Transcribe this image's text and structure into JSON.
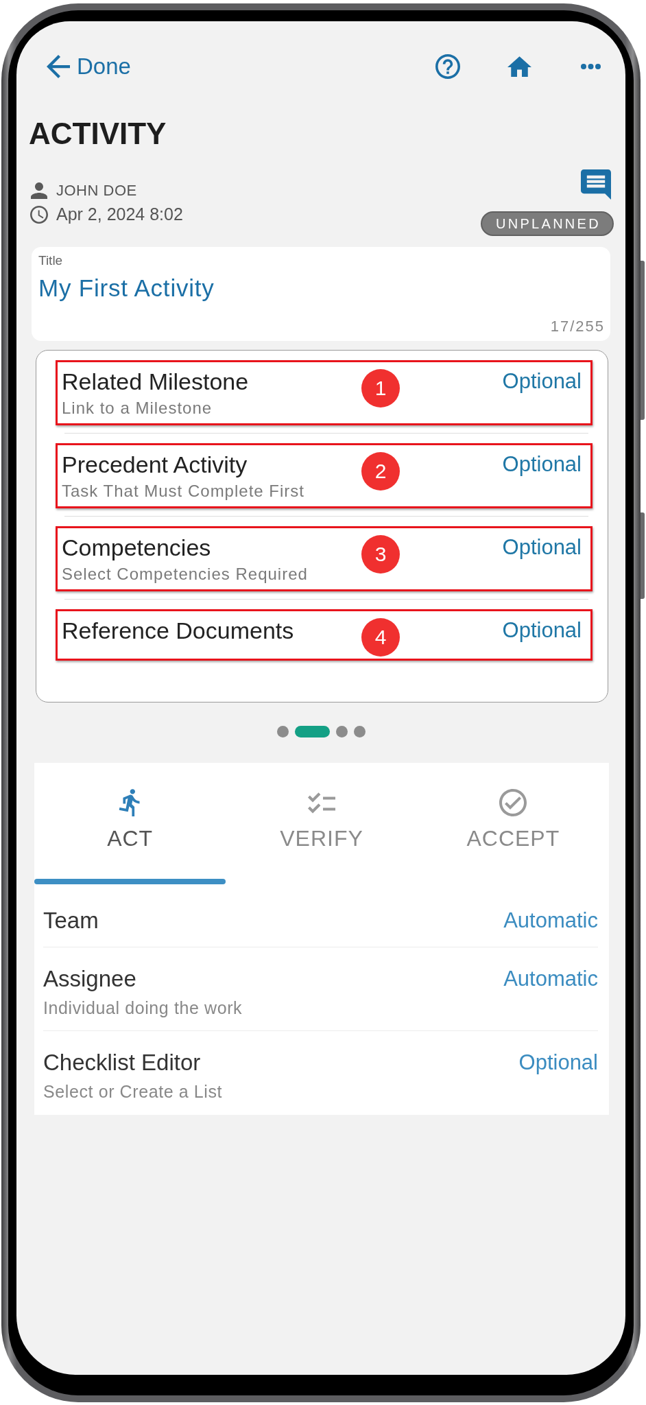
{
  "header": {
    "back_label": "Done"
  },
  "page_title": "ACTIVITY",
  "meta": {
    "owner": "JOHN DOE",
    "timestamp": "Apr 2, 2024 8:02",
    "status_badge": "UNPLANNED"
  },
  "title_field": {
    "label": "Title",
    "value": "My First Activity",
    "counter": "17/255"
  },
  "fields": [
    {
      "title": "Related Milestone",
      "subtitle": "Link to a Milestone",
      "value": "Optional",
      "marker": "1"
    },
    {
      "title": "Precedent Activity",
      "subtitle": "Task That Must Complete First",
      "value": "Optional",
      "marker": "2"
    },
    {
      "title": "Competencies",
      "subtitle": "Select Competencies Required",
      "value": "Optional",
      "marker": "3"
    },
    {
      "title": "Reference Documents",
      "value": "Optional",
      "marker": "4"
    }
  ],
  "pager": [
    {
      "selected": false
    },
    {
      "selected": true
    },
    {
      "selected": false
    },
    {
      "selected": false
    }
  ],
  "lower_panel": {
    "tabs": [
      {
        "label": "ACT",
        "selected": true
      },
      {
        "label": "VERIFY",
        "selected": false
      },
      {
        "label": "ACCEPT",
        "selected": false
      }
    ],
    "rows": [
      {
        "title": "Team",
        "value": "Automatic"
      },
      {
        "title": "Assignee",
        "subtitle": "Individual doing the work",
        "value": "Automatic"
      },
      {
        "title": "Checklist Editor",
        "subtitle": "Select or Create a List",
        "value": "Optional"
      }
    ]
  }
}
